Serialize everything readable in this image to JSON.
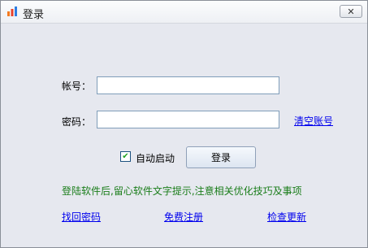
{
  "window": {
    "title": "登录",
    "close_label": "✕"
  },
  "form": {
    "account_label": "帐号：",
    "account_value": "",
    "password_label": "密码：",
    "password_value": "",
    "clear_account_link": "清空账号",
    "auto_start_label": "自动启动",
    "auto_start_checked": true,
    "login_button": "登录"
  },
  "hint_text": "登陆软件后,留心软件文字提示,注意相关优化技巧及事项",
  "footer_links": {
    "retrieve_password": "找回密码",
    "free_register": "免费注册",
    "check_update": "检查更新"
  },
  "colors": {
    "hint": "#1a7d1a",
    "link": "#0000ee"
  }
}
